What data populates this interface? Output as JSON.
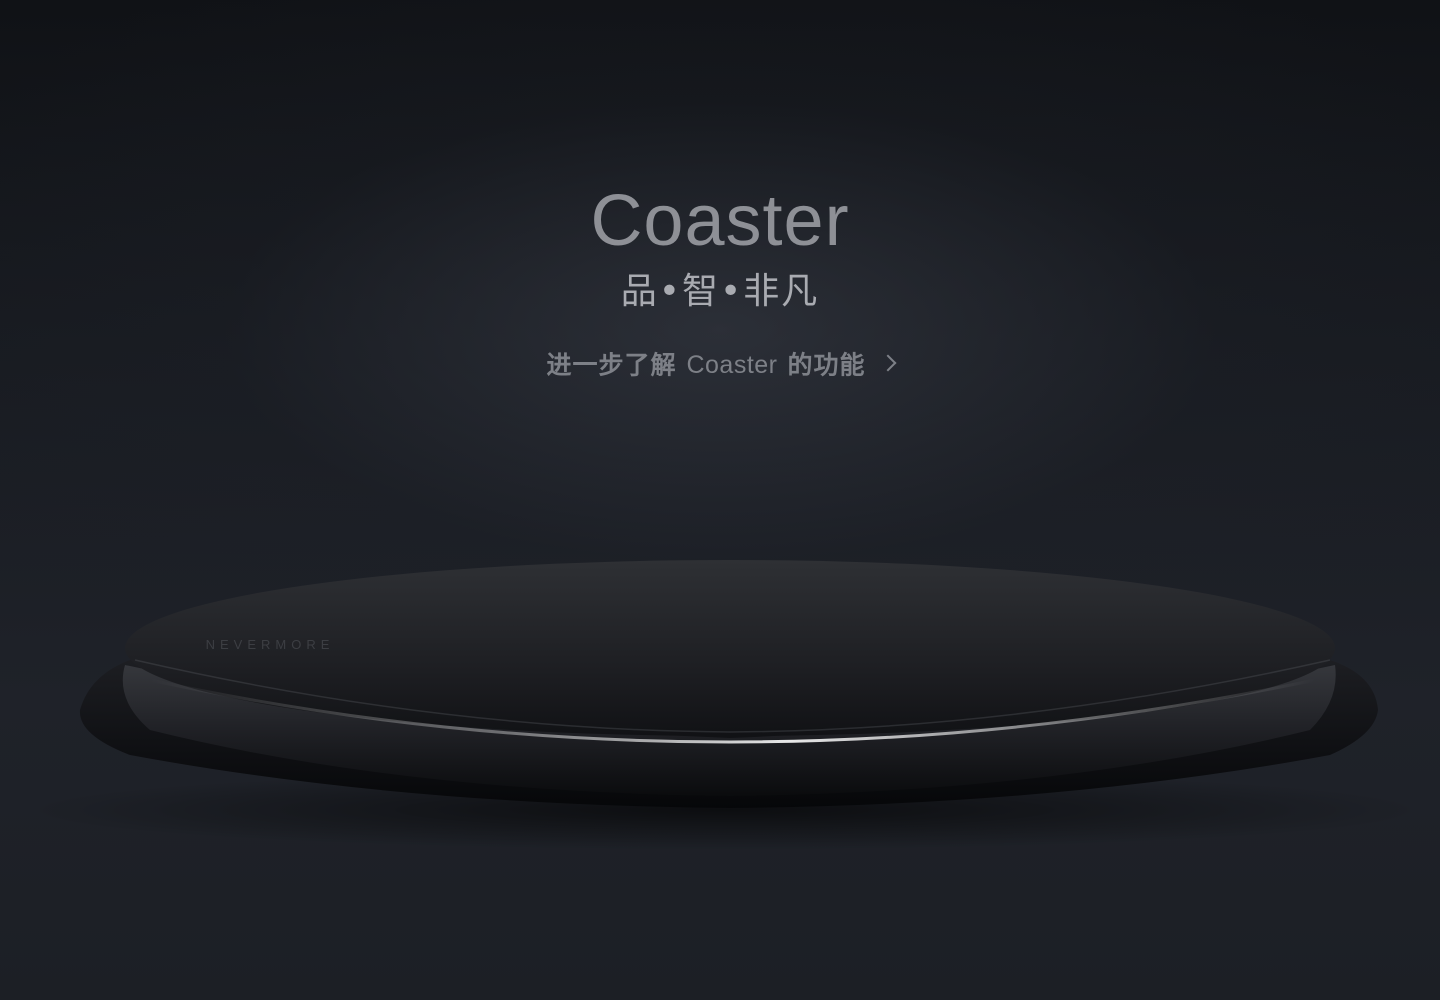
{
  "hero": {
    "title": "Coaster",
    "tagline": "品•智•非凡",
    "learn_more": {
      "prefix": "进一步了解",
      "product": "Coaster",
      "suffix": "的功能",
      "icon": "chevron-right-icon"
    }
  },
  "product_image": {
    "brand_text": "NEVERMORE",
    "colors": {
      "background": "#14161b",
      "title": "#8e9096",
      "tagline": "#a9abb1",
      "link": "#7d8087"
    }
  }
}
